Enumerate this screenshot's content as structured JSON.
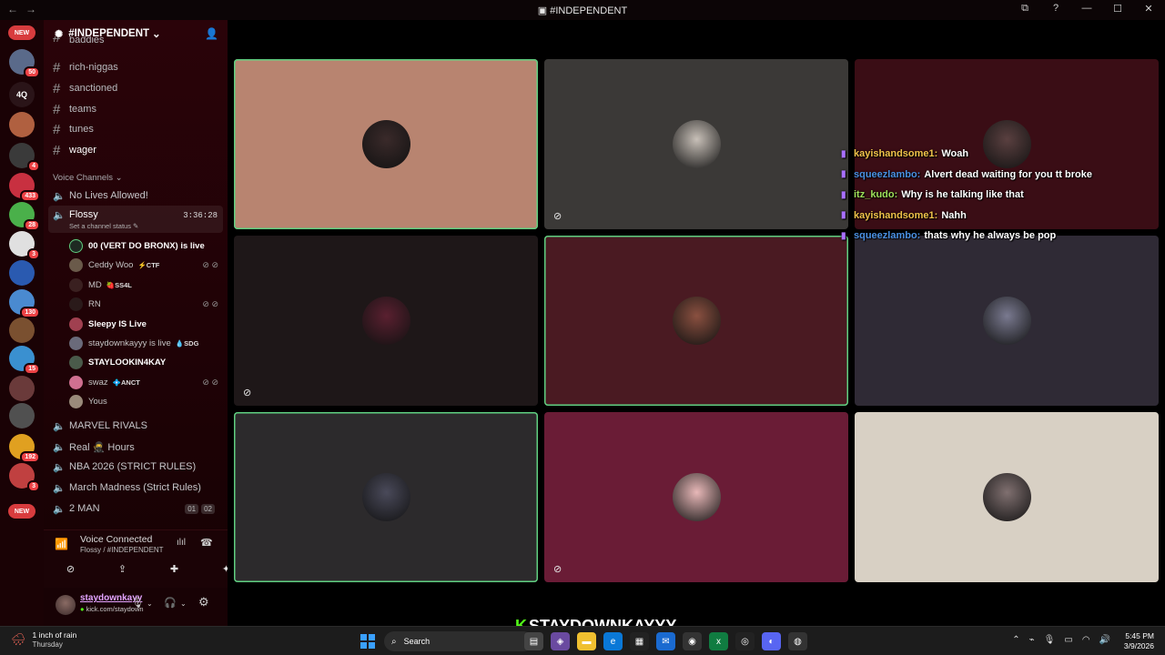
{
  "window": {
    "title": "#INDEPENDENT",
    "nav_back": "←",
    "nav_fwd": "→",
    "ctrl_min": "—",
    "ctrl_max": "☐",
    "ctrl_close": "✕",
    "ctrl_help": "?",
    "ctrl_inbox": "⧉"
  },
  "servers": [
    {
      "label": "NEW",
      "badge": "",
      "color": "#d83c3e",
      "pill": true
    },
    {
      "label": "",
      "badge": "50",
      "color": "#5a6a8a"
    },
    {
      "label": "4Q",
      "badge": "",
      "color": "#2a1418"
    },
    {
      "label": "",
      "badge": "",
      "color": "#b06040"
    },
    {
      "label": "",
      "badge": "4",
      "color": "#3a3a3a"
    },
    {
      "label": "",
      "badge": "433",
      "color": "#c83040"
    },
    {
      "label": "",
      "badge": "28",
      "color": "#4ab04a"
    },
    {
      "label": "",
      "badge": "3",
      "color": "#e0e0e0"
    },
    {
      "label": "",
      "badge": "",
      "color": "#2a5ab0"
    },
    {
      "label": "",
      "badge": "130",
      "color": "#4a8ad0"
    },
    {
      "label": "",
      "badge": "",
      "color": "#7a5030"
    },
    {
      "label": "",
      "badge": "15",
      "color": "#3a90d0"
    },
    {
      "label": "",
      "badge": "",
      "color": "#6a3a3a"
    },
    {
      "label": "",
      "badge": "",
      "color": "#505050"
    },
    {
      "label": "",
      "badge": "192",
      "color": "#e0a020"
    },
    {
      "label": "",
      "badge": "3",
      "color": "#c04040"
    },
    {
      "label": "NEW",
      "badge": "",
      "color": "#d83c3e",
      "pill": true
    }
  ],
  "server": {
    "name": "#INDEPENDENT",
    "chevron": "⌄"
  },
  "text_channels": [
    {
      "name": "baddies",
      "bold": false
    },
    {
      "name": "rich-niggas",
      "bold": false
    },
    {
      "name": "sanctioned",
      "bold": false
    },
    {
      "name": "teams",
      "bold": false
    },
    {
      "name": "tunes",
      "bold": false
    },
    {
      "name": "wager",
      "bold": true
    }
  ],
  "voice_label": "Voice Channels",
  "active_channel": {
    "name": "Flossy",
    "timer": "3:36:28",
    "status": "Set a channel status"
  },
  "members": [
    {
      "name": "00 (VERT DO BRONX) is live",
      "tag": "",
      "bold": true,
      "muted": false,
      "color": "#1e2a22"
    },
    {
      "name": "Ceddy Woo",
      "tag": "⚡CTF",
      "bold": false,
      "muted": true,
      "color": "#6a5a4a"
    },
    {
      "name": "MD",
      "tag": "🍓SS4L",
      "bold": false,
      "muted": false,
      "color": "#3a2020"
    },
    {
      "name": "RN",
      "tag": "",
      "bold": false,
      "muted": true,
      "color": "#2a1a1a"
    },
    {
      "name": "Sleepy IS Live",
      "tag": "",
      "bold": true,
      "muted": false,
      "color": "#a04050"
    },
    {
      "name": "staydownkayyy is live",
      "tag": "💧SDG",
      "bold": false,
      "muted": false,
      "color": "#6a6a7a"
    },
    {
      "name": "STAYLOOKIN4KAY",
      "tag": "",
      "bold": true,
      "muted": false,
      "color": "#4a5a4a"
    },
    {
      "name": "swaz",
      "tag": "💠ANCT",
      "bold": false,
      "muted": true,
      "color": "#d07090"
    },
    {
      "name": "Yous",
      "tag": "",
      "bold": false,
      "muted": false,
      "color": "#9a8a7a"
    }
  ],
  "voice_channels": [
    {
      "name": "No Lives Allowed!"
    },
    {
      "name": "MARVEL RIVALS"
    },
    {
      "name": "Real 🥷 Hours"
    },
    {
      "name": "NBA 2026 (STRICT RULES)"
    },
    {
      "name": "March Madness (Strict Rules)"
    },
    {
      "name": "2 MAN",
      "n1": "01",
      "n2": "02"
    }
  ],
  "voice_status": {
    "title": "Voice Connected",
    "subtitle": "Flossy / #INDEPENDENT"
  },
  "user": {
    "name": "staydownkayy",
    "status": "kick.com/staydown"
  },
  "tiles": [
    {
      "color": "#b88470",
      "avatar": "#3a2a2a",
      "speaking": true,
      "cam_off": false
    },
    {
      "color": "#3b3937",
      "avatar": "#c8c0b8",
      "speaking": false,
      "cam_off": true
    },
    {
      "color": "#3a0d15",
      "avatar": "#5a4040",
      "speaking": false,
      "cam_off": false
    },
    {
      "color": "#1e1718",
      "avatar": "#5a2030",
      "speaking": false,
      "cam_off": true
    },
    {
      "color": "#4a1a22",
      "avatar": "#8a5040",
      "speaking": true,
      "cam_off": false
    },
    {
      "color": "#2f2a35",
      "avatar": "#7a7a90",
      "speaking": false,
      "cam_off": false
    },
    {
      "color": "#2c2a2c",
      "avatar": "#4a4a5a",
      "speaking": true,
      "cam_off": false
    },
    {
      "color": "#6a1c36",
      "avatar": "#e8b8b8",
      "speaking": false,
      "cam_off": true
    },
    {
      "color": "#d8d0c4",
      "avatar": "#807070",
      "speaking": false,
      "cam_off": false
    }
  ],
  "chat": [
    {
      "user": "kayishandsome1:",
      "msg": "Woah",
      "color": "#f0c24a"
    },
    {
      "user": "squeezlambo:",
      "msg": "Alvert dead waiting for you tt broke",
      "color": "#4a90e2"
    },
    {
      "user": "itz_kudo:",
      "msg": "Why is he talking like that",
      "color": "#9ee05a"
    },
    {
      "user": "kayishandsome1:",
      "msg": "Nahh",
      "color": "#f0c24a"
    },
    {
      "user": "squeezlambo:",
      "msg": "thats why he always be pop",
      "color": "#4a90e2"
    }
  ],
  "overlay": {
    "name": "STAYDOWNKAYYY",
    "k": "K"
  },
  "taskbar": {
    "weather_title": "1 inch of rain",
    "weather_sub": "Thursday",
    "search": "Search",
    "time": "5:45 PM",
    "date": "3/9/2026"
  }
}
